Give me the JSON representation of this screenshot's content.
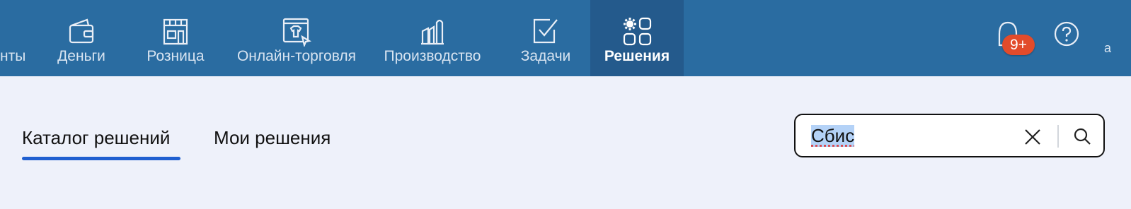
{
  "nav": {
    "items": [
      {
        "label": "нты",
        "icon": "contacts-icon"
      },
      {
        "label": "Деньги",
        "icon": "wallet-icon"
      },
      {
        "label": "Розница",
        "icon": "store-icon"
      },
      {
        "label": "Онлайн-торговля",
        "icon": "online-store-icon"
      },
      {
        "label": "Производство",
        "icon": "factory-icon"
      },
      {
        "label": "Задачи",
        "icon": "tasks-icon"
      },
      {
        "label": "Решения",
        "icon": "solutions-icon",
        "active": true
      }
    ]
  },
  "header": {
    "notifications_badge": "9+",
    "edge_text": "а"
  },
  "tabs": {
    "catalog": "Каталог решений",
    "mine": "Мои решения"
  },
  "search": {
    "value": "Сбис"
  },
  "colors": {
    "topbar": "#2a6ca1",
    "active_nav": "#245a8c",
    "background": "#eef1fa",
    "accent": "#1f5fd0",
    "badge": "#e24b2b"
  }
}
